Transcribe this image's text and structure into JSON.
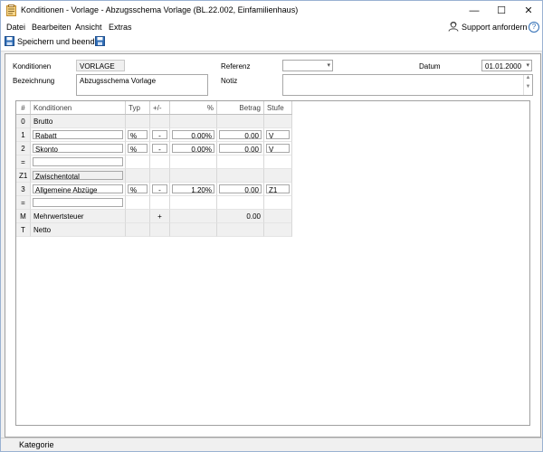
{
  "window": {
    "title": "Konditionen - Vorlage - Abzugsschema Vorlage (BL.22.002, Einfamilienhaus)",
    "minimize": "—",
    "maximize": "☐",
    "close": "✕"
  },
  "menu": {
    "items": [
      "Datei",
      "Bearbeiten",
      "Ansicht",
      "Extras"
    ],
    "support_label": "Support anfordern",
    "help_glyph": "?"
  },
  "toolbar": {
    "save_close_label": "Speichern und beenden"
  },
  "form": {
    "konditionen_label": "Konditionen",
    "konditionen_value": "VORLAGE",
    "bezeichnung_label": "Bezeichnung",
    "bezeichnung_value": "Abzugsschema Vorlage",
    "referenz_label": "Referenz",
    "referenz_value": "",
    "notiz_label": "Notiz",
    "notiz_value": "",
    "datum_label": "Datum",
    "datum_value": "01.01.2000"
  },
  "grid": {
    "headers": [
      "#",
      "Konditionen",
      "Typ",
      "+/-",
      "%",
      "Betrag",
      "Stufe"
    ],
    "rows": [
      {
        "num": "0",
        "name": "Brutto",
        "typ": "",
        "sign": "",
        "pct": "",
        "betrag": "",
        "stufe": "",
        "kind": "header"
      },
      {
        "num": "1",
        "name": "Rabatt",
        "typ": "%",
        "sign": "-",
        "pct": "0.00%",
        "betrag": "0.00",
        "stufe": "V",
        "kind": "edit"
      },
      {
        "num": "2",
        "name": "Skonto",
        "typ": "%",
        "sign": "-",
        "pct": "0.00%",
        "betrag": "0.00",
        "stufe": "V",
        "kind": "edit"
      },
      {
        "num": "=",
        "name": "",
        "typ": "",
        "sign": "",
        "pct": "",
        "betrag": "",
        "stufe": "",
        "kind": "blank"
      },
      {
        "num": "Z1",
        "name": "Zwischentotal",
        "typ": "",
        "sign": "",
        "pct": "",
        "betrag": "",
        "stufe": "",
        "kind": "subtotal"
      },
      {
        "num": "3",
        "name": "Allgemeine Abzüge",
        "typ": "%",
        "sign": "-",
        "pct": "1.20%",
        "betrag": "0.00",
        "stufe": "Z1",
        "kind": "edit"
      },
      {
        "num": "=",
        "name": "",
        "typ": "",
        "sign": "",
        "pct": "",
        "betrag": "",
        "stufe": "",
        "kind": "blank"
      },
      {
        "num": "M",
        "name": "Mehrwertsteuer",
        "typ": "",
        "sign": "+",
        "pct": "",
        "betrag": "0.00",
        "stufe": "",
        "kind": "plain"
      },
      {
        "num": "T",
        "name": "Netto",
        "typ": "",
        "sign": "",
        "pct": "",
        "betrag": "",
        "stufe": "",
        "kind": "header"
      }
    ]
  },
  "status": {
    "kategorie": "Kategorie"
  },
  "colors": {
    "window_border": "#9ab2d2",
    "save_icon": "#2f6db5",
    "row_shade": "#f0f0f0"
  }
}
